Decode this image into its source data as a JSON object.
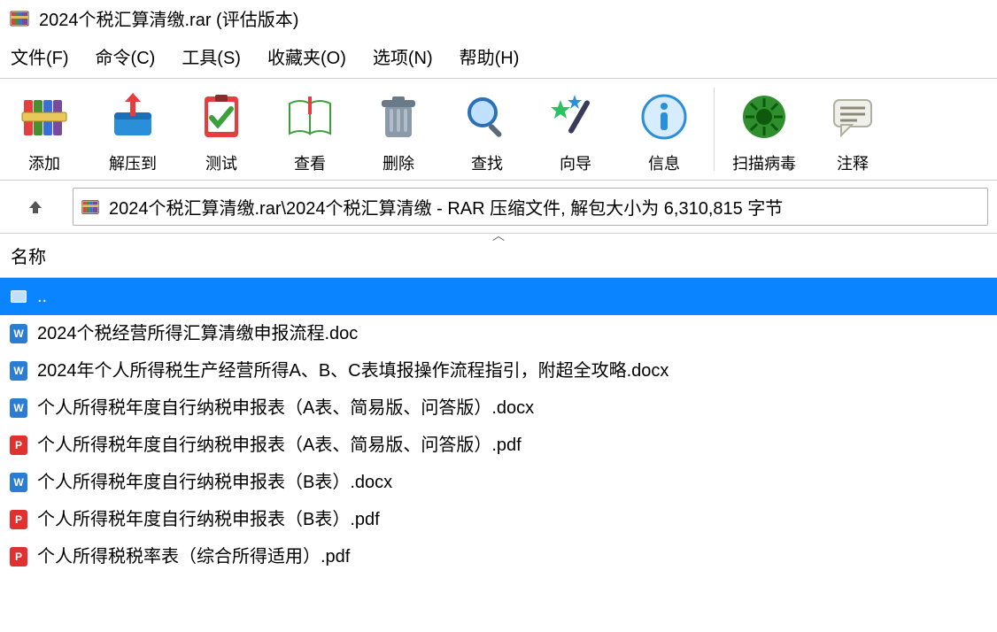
{
  "title": "2024个税汇算清缴.rar (评估版本)",
  "menu": {
    "file": "文件(F)",
    "command": "命令(C)",
    "tools": "工具(S)",
    "favorites": "收藏夹(O)",
    "options": "选项(N)",
    "help": "帮助(H)"
  },
  "toolbar": {
    "add": "添加",
    "extract": "解压到",
    "test": "测试",
    "view": "查看",
    "delete": "删除",
    "find": "查找",
    "wizard": "向导",
    "info": "信息",
    "scan": "扫描病毒",
    "comment": "注释"
  },
  "path": "2024个税汇算清缴.rar\\2024个税汇算清缴 - RAR 压缩文件, 解包大小为 6,310,815 字节",
  "column_name": "名称",
  "files": [
    {
      "type": "up",
      "name": ".."
    },
    {
      "type": "doc",
      "name": "2024个税经营所得汇算清缴申报流程.doc"
    },
    {
      "type": "doc",
      "name": "2024年个人所得税生产经营所得A、B、C表填报操作流程指引，附超全攻略.docx"
    },
    {
      "type": "doc",
      "name": "个人所得税年度自行纳税申报表（A表、简易版、问答版）.docx"
    },
    {
      "type": "pdf",
      "name": "个人所得税年度自行纳税申报表（A表、简易版、问答版）.pdf"
    },
    {
      "type": "doc",
      "name": "个人所得税年度自行纳税申报表（B表）.docx"
    },
    {
      "type": "pdf",
      "name": "个人所得税年度自行纳税申报表（B表）.pdf"
    },
    {
      "type": "pdf",
      "name": "个人所得税税率表（综合所得适用）.pdf"
    }
  ]
}
